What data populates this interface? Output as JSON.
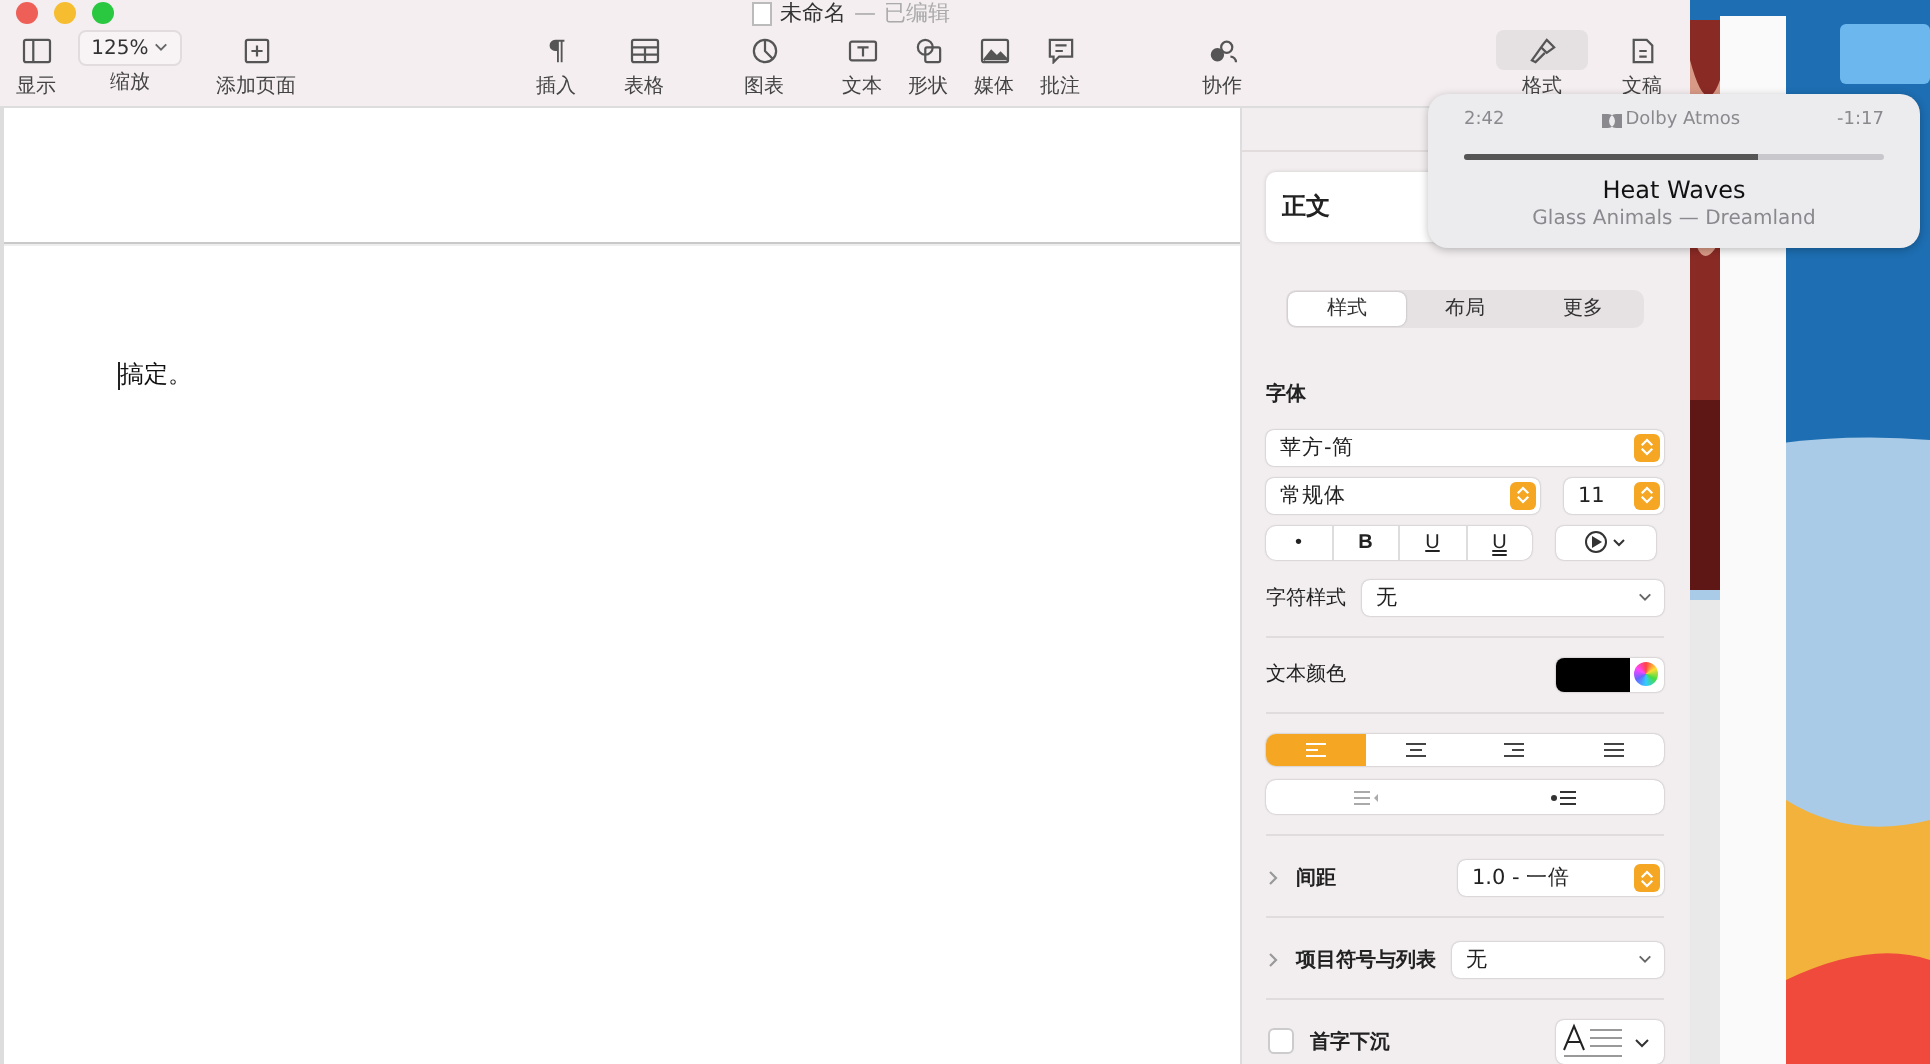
{
  "window": {
    "title": "未命名",
    "separator": "—",
    "status": "已编辑"
  },
  "toolbar": {
    "left": [
      {
        "kind": "view",
        "label": "显示"
      },
      {
        "kind": "zoom",
        "value": "125%",
        "label": "缩放"
      },
      {
        "kind": "addpage",
        "label": "添加页面"
      }
    ],
    "center": [
      {
        "kind": "insert",
        "label": "插入"
      },
      {
        "kind": "table",
        "label": "表格"
      },
      {
        "kind": "chart",
        "label": "图表"
      },
      {
        "kind": "text",
        "label": "文本"
      },
      {
        "kind": "shape",
        "label": "形状"
      },
      {
        "kind": "media",
        "label": "媒体"
      },
      {
        "kind": "comment",
        "label": "批注"
      }
    ],
    "collab": {
      "label": "协作"
    },
    "right": [
      {
        "kind": "format",
        "label": "格式",
        "selected": true
      },
      {
        "kind": "document",
        "label": "文稿",
        "selected": false
      }
    ]
  },
  "document": {
    "text": "搞定。"
  },
  "sidebar": {
    "paragraph_style": "正文",
    "tabs": [
      {
        "label": "样式",
        "selected": true
      },
      {
        "label": "布局",
        "selected": false
      },
      {
        "label": "更多",
        "selected": false
      }
    ],
    "font_heading": "字体",
    "font_family": "苹方-简",
    "typeface": "常规体",
    "size": "11",
    "style_buttons": [
      {
        "kind": "bullet",
        "label": "•"
      },
      {
        "kind": "bold",
        "label": "B"
      },
      {
        "kind": "underline",
        "label": "U"
      },
      {
        "kind": "strike",
        "label": "U"
      }
    ],
    "character_style": {
      "label": "字符样式",
      "value": "无"
    },
    "text_color": {
      "label": "文本颜色",
      "color": "#000000"
    },
    "alignment": [
      {
        "kind": "left",
        "selected": true
      },
      {
        "kind": "center",
        "selected": false
      },
      {
        "kind": "right",
        "selected": false
      },
      {
        "kind": "justify",
        "selected": false
      }
    ],
    "spacing": {
      "label": "间距",
      "value": "1.0 - 一倍",
      "expanded": false
    },
    "lists": {
      "label": "项目符号与列表",
      "value": "无",
      "expanded": false
    },
    "drop_cap": {
      "label": "首字下沉",
      "checked": false
    }
  },
  "now_playing": {
    "elapsed": "2:42",
    "badge": "Dolby Atmos",
    "remaining": "-1:17",
    "level": 0.7,
    "title": "Heat Waves",
    "subtitle": "Glass Animals — Dreamland"
  }
}
